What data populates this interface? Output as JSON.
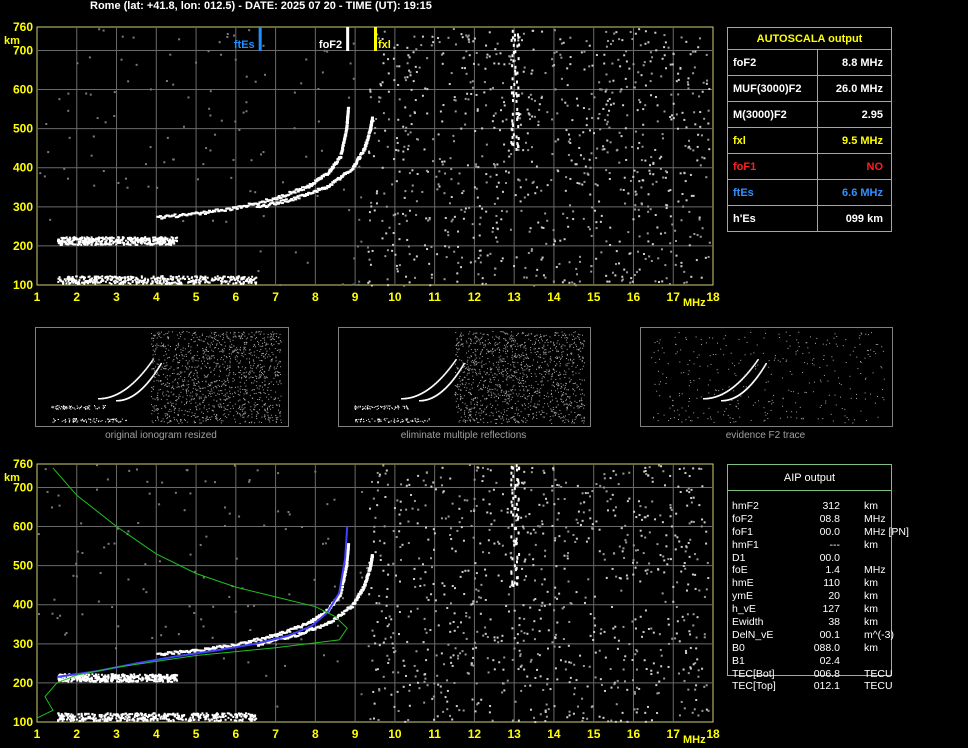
{
  "header": "Rome (lat: +41.8, lon: 012.5) - DATE: 2025 07 20 - TIME (UT): 19:15",
  "chart_data": [
    {
      "type": "scatter",
      "name": "ionogram-top",
      "xlim": [
        1,
        18
      ],
      "ylim": [
        100,
        760
      ],
      "x_ticks": [
        "1",
        "2",
        "3",
        "4",
        "5",
        "6",
        "7",
        "8",
        "9",
        "10",
        "11",
        "12",
        "13",
        "14",
        "15",
        "16",
        "17",
        "18"
      ],
      "y_ticks": [
        "100",
        "200",
        "300",
        "400",
        "500",
        "600",
        "700",
        "760"
      ],
      "xlabel": "MHz",
      "ylabel": "km",
      "markers": [
        {
          "label": "ftEs",
          "x": 6.6,
          "color": "#1e90ff"
        },
        {
          "label": "foF2",
          "x": 8.8,
          "color": "#ffffff"
        },
        {
          "label": "fxl",
          "x": 9.5,
          "color": "#ffff00"
        }
      ],
      "traces": [
        {
          "name": "E layer",
          "x_from": 1.5,
          "x_to": 6.5,
          "y": 115
        },
        {
          "name": "Es layer",
          "x_from": 1.5,
          "x_to": 4.5,
          "y": 215
        },
        {
          "name": "F2 ordinary",
          "points": [
            [
              4.0,
              275
            ],
            [
              5.0,
              285
            ],
            [
              6.0,
              300
            ],
            [
              7.0,
              325
            ],
            [
              7.8,
              355
            ],
            [
              8.3,
              390
            ],
            [
              8.6,
              430
            ],
            [
              8.75,
              500
            ],
            [
              8.8,
              560
            ]
          ]
        },
        {
          "name": "F2 extraordinary",
          "points": [
            [
              6.5,
              300
            ],
            [
              7.5,
              325
            ],
            [
              8.3,
              355
            ],
            [
              8.9,
              400
            ],
            [
              9.2,
              450
            ],
            [
              9.35,
              500
            ],
            [
              9.4,
              530
            ]
          ]
        }
      ],
      "grid": true
    },
    {
      "type": "scatter",
      "name": "ionogram-bottom",
      "xlim": [
        1,
        18
      ],
      "ylim": [
        100,
        760
      ],
      "x_ticks": [
        "1",
        "2",
        "3",
        "4",
        "5",
        "6",
        "7",
        "8",
        "9",
        "10",
        "11",
        "12",
        "13",
        "14",
        "15",
        "16",
        "17",
        "18"
      ],
      "y_ticks": [
        "100",
        "200",
        "300",
        "400",
        "500",
        "600",
        "700",
        "760"
      ],
      "xlabel": "MHz",
      "ylabel": "km",
      "traces": [
        {
          "name": "E layer",
          "x_from": 1.5,
          "x_to": 6.5,
          "y": 115
        },
        {
          "name": "Es layer",
          "x_from": 1.5,
          "x_to": 4.5,
          "y": 215
        },
        {
          "name": "F2 ordinary",
          "points": [
            [
              4.0,
              275
            ],
            [
              5.0,
              285
            ],
            [
              6.0,
              300
            ],
            [
              7.0,
              325
            ],
            [
              7.8,
              355
            ],
            [
              8.3,
              390
            ],
            [
              8.6,
              430
            ],
            [
              8.75,
              500
            ],
            [
              8.8,
              560
            ]
          ]
        },
        {
          "name": "F2 extraordinary",
          "points": [
            [
              6.5,
              300
            ],
            [
              7.5,
              325
            ],
            [
              8.3,
              355
            ],
            [
              8.9,
              400
            ],
            [
              9.2,
              450
            ],
            [
              9.35,
              500
            ],
            [
              9.4,
              530
            ]
          ]
        },
        {
          "name": "AIP fit",
          "color": "#4040ff",
          "points": [
            [
              1.5,
              215
            ],
            [
              2.5,
              230
            ],
            [
              3.5,
              250
            ],
            [
              4.5,
              268
            ],
            [
              5.5,
              283
            ],
            [
              6.5,
              300
            ],
            [
              7.3,
              320
            ],
            [
              7.9,
              345
            ],
            [
              8.3,
              380
            ],
            [
              8.6,
              430
            ],
            [
              8.75,
              520
            ],
            [
              8.8,
              600
            ]
          ]
        },
        {
          "name": "profile",
          "color": "#20c020",
          "points": [
            [
              1.4,
              750
            ],
            [
              2,
              680
            ],
            [
              3,
              600
            ],
            [
              4,
              530
            ],
            [
              5,
              480
            ],
            [
              6,
              445
            ],
            [
              7,
              420
            ],
            [
              8,
              395
            ],
            [
              8.5,
              370
            ],
            [
              8.8,
              340
            ],
            [
              8.6,
              310
            ],
            [
              7,
              290
            ],
            [
              5,
              270
            ],
            [
              3,
              240
            ],
            [
              2,
              220
            ],
            [
              1.5,
              200
            ],
            [
              1.2,
              165
            ],
            [
              1.4,
              130
            ],
            [
              1.0,
              110
            ]
          ]
        }
      ],
      "grid": true
    }
  ],
  "autoscala": {
    "title": "AUTOSCALA output",
    "rows": [
      {
        "key": "foF2",
        "value": "8.8 MHz",
        "color": "#ffffff"
      },
      {
        "key": "MUF(3000)F2",
        "value": "26.0 MHz",
        "color": "#ffffff"
      },
      {
        "key": "M(3000)F2",
        "value": "2.95",
        "color": "#ffffff"
      },
      {
        "key": "fxl",
        "value": "9.5 MHz",
        "color": "#ffff00"
      },
      {
        "key": "foF1",
        "value": "NO",
        "color": "#ff2020"
      },
      {
        "key": "ftEs",
        "value": "6.6 MHz",
        "color": "#3090ff"
      },
      {
        "key": "h'Es",
        "value": "099     km",
        "color": "#ffffff"
      }
    ]
  },
  "thumbnails": [
    {
      "caption": "original ionogram resized"
    },
    {
      "caption": "eliminate multiple reflections"
    },
    {
      "caption": "evidence F2 trace"
    }
  ],
  "aip": {
    "title": "AIP output",
    "rows": [
      {
        "k": "hmF2",
        "v": "312",
        "u": "km"
      },
      {
        "k": "foF2",
        "v": "08.8",
        "u": "MHz"
      },
      {
        "k": "foF1",
        "v": "00.0",
        "u": "MHz   [PN]"
      },
      {
        "k": "hmF1",
        "v": "---",
        "u": "km"
      },
      {
        "k": "D1",
        "v": "00.0",
        "u": ""
      },
      {
        "k": "foE",
        "v": "1.4",
        "u": "MHz"
      },
      {
        "k": "hmE",
        "v": "110",
        "u": "km"
      },
      {
        "k": "ymE",
        "v": "20",
        "u": "km"
      },
      {
        "k": "h_vE",
        "v": "127",
        "u": "km"
      },
      {
        "k": "Ewidth",
        "v": "38",
        "u": "km"
      },
      {
        "k": "DelN_vE",
        "v": "00.1",
        "u": "m^(-3)"
      },
      {
        "k": "B0",
        "v": "088.0",
        "u": "km"
      },
      {
        "k": "B1",
        "v": "02.4",
        "u": ""
      },
      {
        "k": "TEC[Bot]",
        "v": "006.8",
        "u": "TECU"
      },
      {
        "k": "TEC[Top]",
        "v": "012.1",
        "u": "TECU"
      }
    ]
  }
}
